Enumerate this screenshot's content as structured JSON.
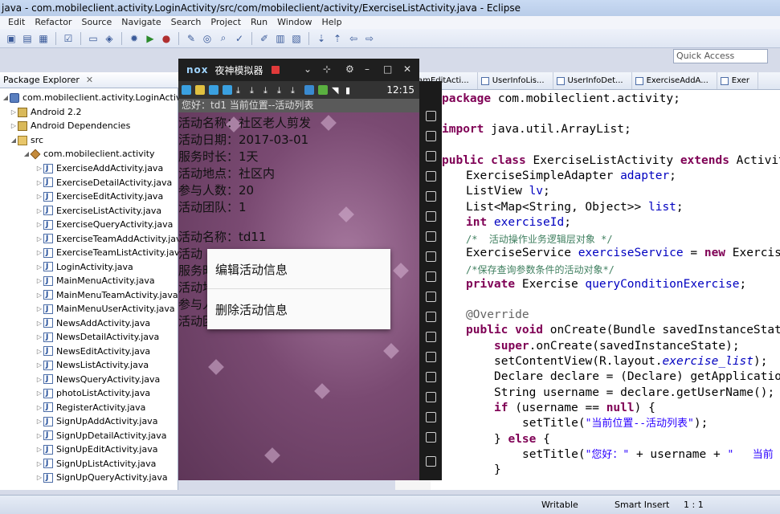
{
  "window": {
    "title": "java - com.mobileclient.activity.LoginActivity/src/com/mobileclient/activity/ExerciseListActivity.java - Eclipse"
  },
  "menu": [
    "Edit",
    "Refactor",
    "Source",
    "Navigate",
    "Search",
    "Project",
    "Run",
    "Window",
    "Help"
  ],
  "quick_access": {
    "placeholder": "Quick Access"
  },
  "package_explorer": {
    "tab_label": "Package Explorer",
    "close_glyph": "✕",
    "project": "com.mobileclient.activity.LoginActivity",
    "lib_android": "Android 2.2",
    "lib_deps": "Android Dependencies",
    "src": "src",
    "package": "com.mobileclient.activity",
    "files": [
      "ExerciseAddActivity.java",
      "ExerciseDetailActivity.java",
      "ExerciseEditActivity.java",
      "ExerciseListActivity.java",
      "ExerciseQueryActivity.java",
      "ExerciseTeamAddActivity.java",
      "ExerciseTeamListActivity.java",
      "LoginActivity.java",
      "MainMenuActivity.java",
      "MainMenuTeamActivity.java",
      "MainMenuUserActivity.java",
      "NewsAddActivity.java",
      "NewsDetailActivity.java",
      "NewsEditActivity.java",
      "NewsListActivity.java",
      "NewsQueryActivity.java",
      "photoListActivity.java",
      "RegisterActivity.java",
      "SignUpAddActivity.java",
      "SignUpDetailActivity.java",
      "SignUpEditActivity.java",
      "SignUpListActivity.java",
      "SignUpQueryActivity.java"
    ]
  },
  "editor_tabs": [
    "teamEditActi...",
    "UserInfoLis...",
    "UserInfoDet...",
    "ExerciseAddA...",
    "Exer"
  ],
  "code_lines": {
    "l1a": "package",
    "l1b": " com.mobileclient.activity;",
    "l2a": "import",
    "l2b": " java.util.ArrayList;",
    "l3a": "public class",
    "l3b": " ExerciseListActivity ",
    "l3c": "extends",
    "l3d": " Activit",
    "l4a": "ExerciseSimpleAdapter ",
    "l4b": "adapter",
    "l4c": ";",
    "l5a": "ListView ",
    "l5b": "lv",
    "l5c": ";",
    "l6a": "List<Map<String, Object>> ",
    "l6b": "list",
    "l6c": ";",
    "l7a": "int",
    "l7b": " exerciseId",
    "l7c": ";",
    "l8": "/*  活动操作业务逻辑层对象 */",
    "l9a": "ExerciseService ",
    "l9b": "exerciseService",
    "l9c": " = ",
    "l9d": "new",
    "l9e": " Exercis",
    "l10": "/*保存查询参数条件的活动对象*/",
    "l11a": "private",
    "l11b": " Exercise ",
    "l11c": "queryConditionExercise",
    "l11d": ";",
    "l12": "@Override",
    "l13a": "public void",
    "l13b": " onCreate(Bundle savedInstanceStat",
    "l14a": "super",
    "l14b": ".onCreate(savedInstanceState);",
    "l15a": "setContentView(R.layout.",
    "l15b": "exercise_list",
    "l15c": ");",
    "l16": "Declare declare = (Declare) getApplicatio",
    "l17": "String username = declare.getUserName();",
    "l18a": "if",
    "l18b": " (username == ",
    "l18c": "null",
    "l18d": ") {",
    "l19a": "setTitle(",
    "l19b": "\"当前位置--活动列表\"",
    "l19c": ");",
    "l20a": "} ",
    "l20b": "else",
    "l20c": " {",
    "l21a": "setTitle(",
    "l21b": "\"您好：\"",
    "l21c": " + username + ",
    "l21d": "\"   当前",
    "l22": "}"
  },
  "status": {
    "writable": "Writable",
    "insert": "Smart Insert",
    "position": "1 : 1"
  },
  "emulator": {
    "logo": "nox",
    "title": "夜神模拟器",
    "clock": "12:15",
    "app_title": "您好：td1  当前位置--活动列表",
    "record1": [
      "活动名称：社区老人剪发",
      "活动日期：2017-03-01",
      "服务时长：1天",
      "活动地点：社区内",
      "参与人数：20",
      "活动团队：1"
    ],
    "record2": [
      "活动名称：td11",
      "活动",
      "服务时",
      "活动地",
      "参与人",
      "活动团"
    ],
    "dialog": {
      "edit": "编辑活动信息",
      "delete": "删除活动信息"
    }
  }
}
